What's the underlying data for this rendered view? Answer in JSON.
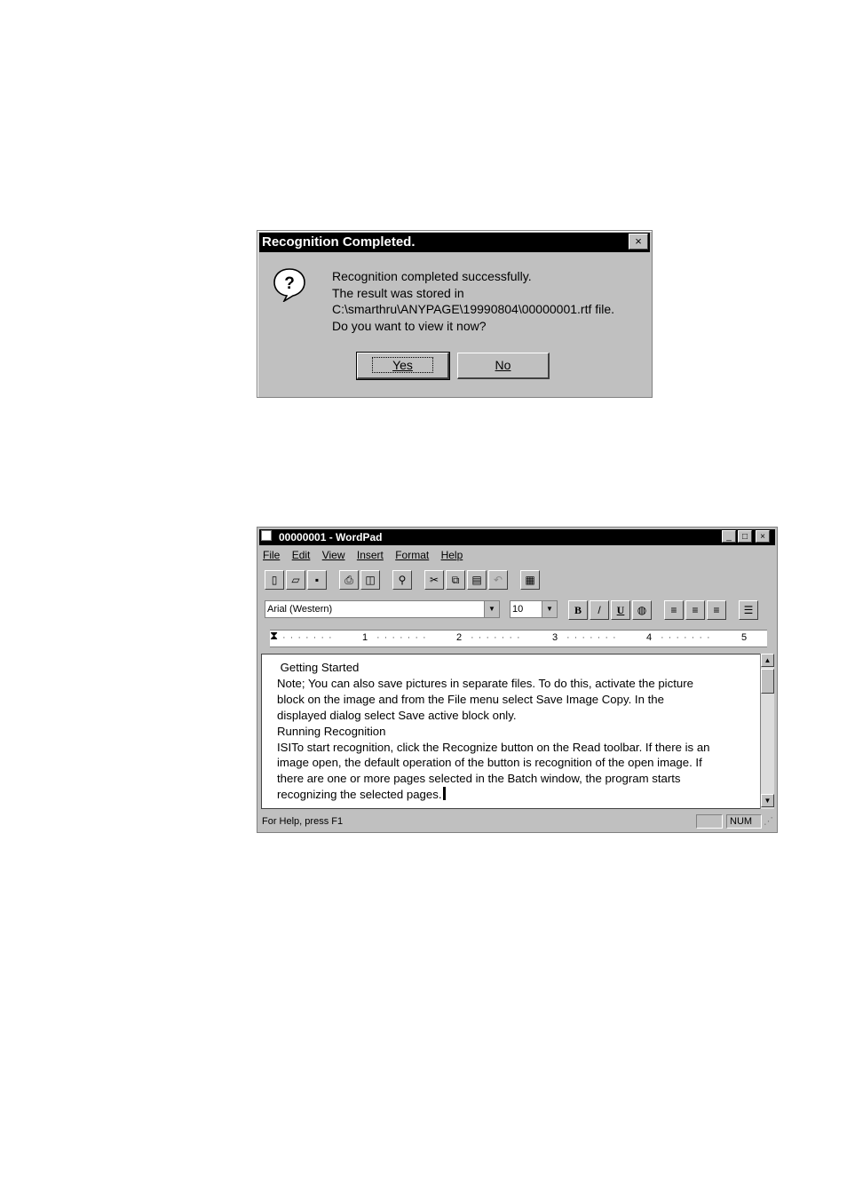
{
  "dialog": {
    "title": "Recognition Completed.",
    "close_glyph": "×",
    "message_lines": [
      "Recognition completed successfully.",
      "The result was stored in",
      "C:\\smarthru\\ANYPAGE\\19990804\\00000001.rtf file.",
      "Do you want to view it now?"
    ],
    "yes_label": "Yes",
    "no_label": "No"
  },
  "wordpad": {
    "title": "00000001 - WordPad",
    "menu": [
      "File",
      "Edit",
      "View",
      "Insert",
      "Format",
      "Help"
    ],
    "font": "Arial (Western)",
    "size": "10",
    "format_buttons": [
      "B",
      "/",
      "U"
    ],
    "ruler_marks": [
      "1",
      "2",
      "3",
      "4",
      "5"
    ],
    "document_lines": [
      " Getting Started",
      "Note; You can also save pictures in separate files. To do this, activate the picture",
      "block on the image and from the File menu select Save Image Copy. In the",
      "displayed dialog select Save active block only.",
      "Running Recognition",
      "ISITo start recognition, click the Recognize button on the Read toolbar. If there is an",
      "image open, the default operation of the button is recognition of the open image. If",
      "there are one or more pages selected in the Batch window, the program starts",
      "recognizing the selected pages."
    ],
    "status_text": "For Help, press F1",
    "status_num": "NUM"
  }
}
